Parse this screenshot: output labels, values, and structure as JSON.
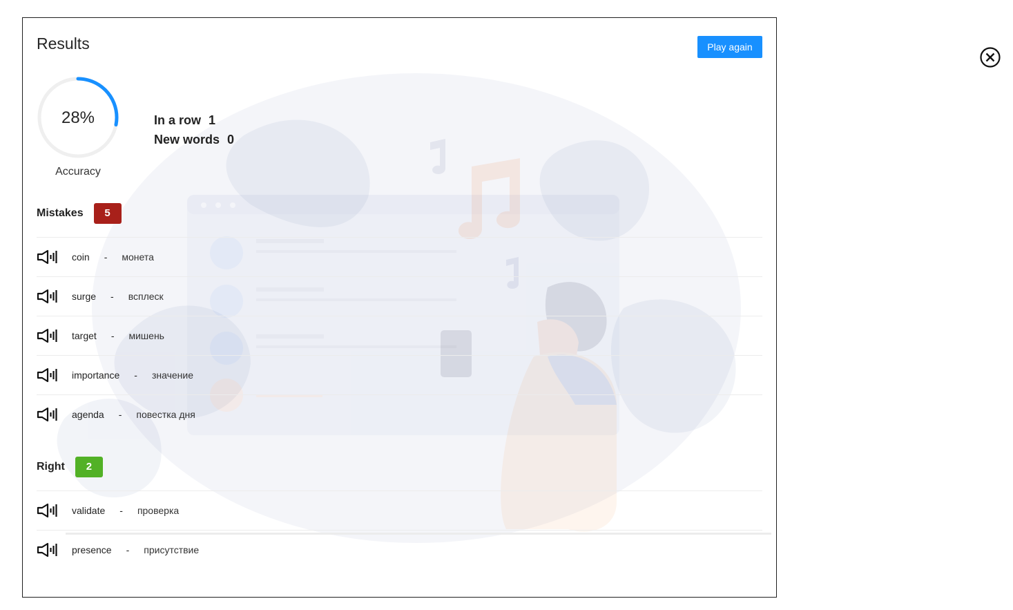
{
  "modal": {
    "title": "Results",
    "play_again_label": "Play again"
  },
  "close_icon": "close-circle-icon",
  "accuracy": {
    "value_text": "28%",
    "fraction": 0.28,
    "label": "Accuracy",
    "track_color": "#eeeeee",
    "progress_color": "#1890ff"
  },
  "stats": {
    "in_a_row_label": "In a row",
    "in_a_row_value": "1",
    "new_words_label": "New words",
    "new_words_value": "0"
  },
  "mistakes": {
    "label": "Mistakes",
    "count": "5",
    "badge_color": "#a8201a",
    "items": [
      {
        "word": "coin",
        "dash": "-",
        "translation": "монета"
      },
      {
        "word": "surge",
        "dash": "-",
        "translation": "всплеск"
      },
      {
        "word": "target",
        "dash": "-",
        "translation": "мишень"
      },
      {
        "word": "importance",
        "dash": "-",
        "translation": "значение"
      },
      {
        "word": "agenda",
        "dash": "-",
        "translation": "повестка дня"
      }
    ]
  },
  "right": {
    "label": "Right",
    "count": "2",
    "badge_color": "#52b126",
    "items": [
      {
        "word": "validate",
        "dash": "-",
        "translation": "проверка"
      },
      {
        "word": "presence",
        "dash": "-",
        "translation": "присутствие"
      }
    ]
  },
  "icons": {
    "sound": "speaker-icon",
    "background": "music-listening-illustration"
  }
}
